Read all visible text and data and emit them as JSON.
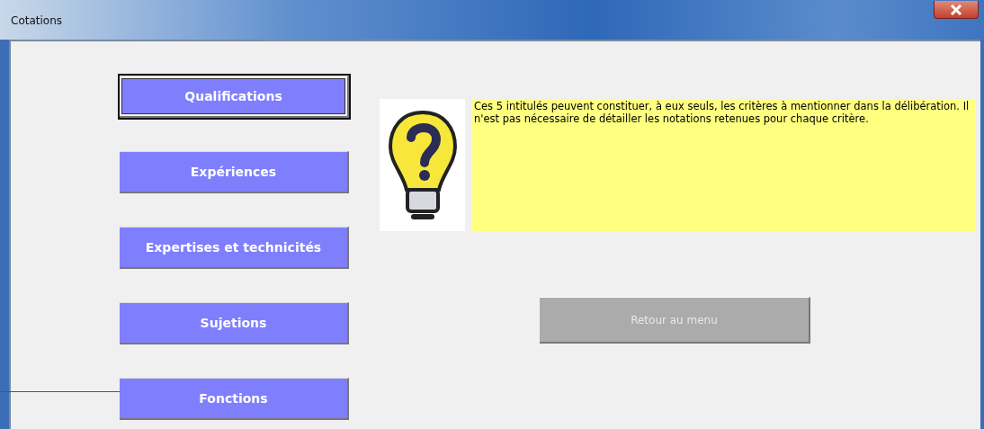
{
  "window": {
    "title": "Cotations"
  },
  "buttons": [
    {
      "label": "Qualifications",
      "focused": true
    },
    {
      "label": "Expériences",
      "focused": false
    },
    {
      "label": "Expertises et technicités",
      "focused": false
    },
    {
      "label": "Sujetions",
      "focused": false
    },
    {
      "label": "Fonctions",
      "focused": false
    }
  ],
  "info": {
    "text": "Ces 5 intitulés peuvent constituer, à eux seuls, les critères à mentionner dans la délibération. Il n'est pas nécessaire de détailler les notations retenues pour chaque critère."
  },
  "return_button": {
    "label": "Retour au menu",
    "disabled": true
  }
}
